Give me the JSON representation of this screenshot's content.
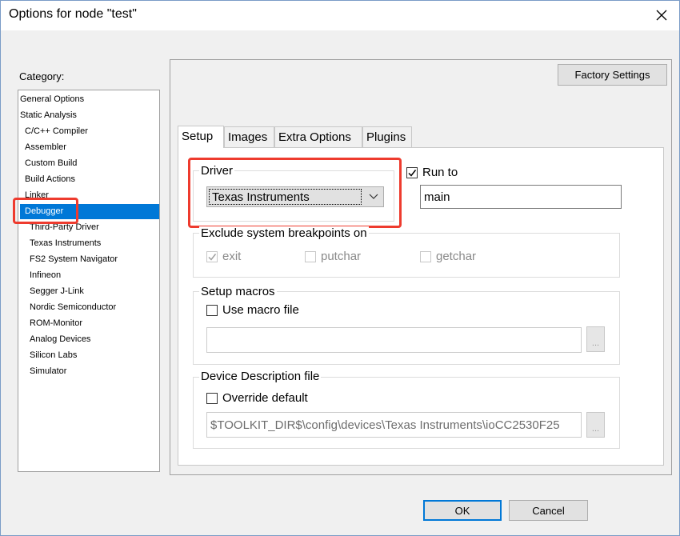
{
  "window": {
    "title": "Options for node \"test\""
  },
  "sidebar": {
    "label": "Category:",
    "items": [
      {
        "label": "General Options",
        "level": 1
      },
      {
        "label": "Static Analysis",
        "level": 1
      },
      {
        "label": "C/C++ Compiler",
        "level": 2
      },
      {
        "label": "Assembler",
        "level": 2
      },
      {
        "label": "Custom Build",
        "level": 2
      },
      {
        "label": "Build Actions",
        "level": 2
      },
      {
        "label": "Linker",
        "level": 2
      },
      {
        "label": "Debugger",
        "level": 2,
        "selected": true
      },
      {
        "label": "Third-Party Driver",
        "level": 3
      },
      {
        "label": "Texas Instruments",
        "level": 3
      },
      {
        "label": "FS2 System Navigator",
        "level": 3
      },
      {
        "label": "Infineon",
        "level": 3
      },
      {
        "label": "Segger J-Link",
        "level": 3
      },
      {
        "label": "Nordic Semiconductor",
        "level": 3
      },
      {
        "label": "ROM-Monitor",
        "level": 3
      },
      {
        "label": "Analog Devices",
        "level": 3
      },
      {
        "label": "Silicon Labs",
        "level": 3
      },
      {
        "label": "Simulator",
        "level": 3
      }
    ]
  },
  "panel": {
    "factory_settings": "Factory Settings",
    "tabs": [
      "Setup",
      "Images",
      "Extra Options",
      "Plugins"
    ],
    "active_tab": "Setup",
    "driver": {
      "label": "Driver",
      "value": "Texas Instruments"
    },
    "run_to": {
      "label": "Run to",
      "checked": true,
      "value": "main"
    },
    "exclude": {
      "label": "Exclude system breakpoints on",
      "exit": "exit",
      "putchar": "putchar",
      "getchar": "getchar"
    },
    "setup_macros": {
      "label": "Setup macros",
      "use_macro": "Use macro file",
      "browse": "..."
    },
    "device": {
      "label": "Device Description file",
      "override": "Override default",
      "path": "$TOOLKIT_DIR$\\config\\devices\\Texas Instruments\\ioCC2530F25",
      "browse": "..."
    }
  },
  "footer": {
    "ok": "OK",
    "cancel": "Cancel"
  },
  "colors": {
    "selection": "#0078d7",
    "highlight": "#ee3b2e"
  }
}
